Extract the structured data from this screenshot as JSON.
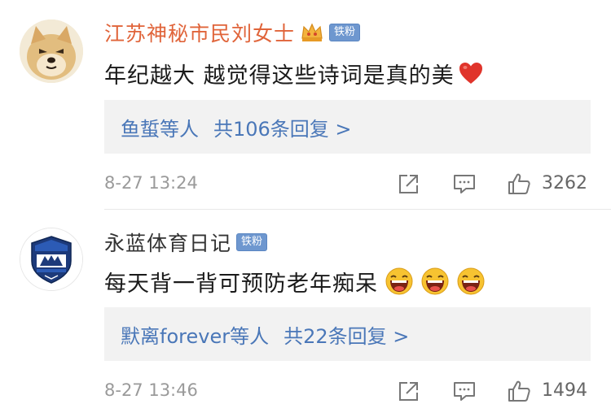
{
  "comments": [
    {
      "username": "江苏神秘市民刘女士",
      "badge": "铁粉",
      "text": "年纪越大 越觉得这些诗词是真的美",
      "reply_users": "鱼蜇等人",
      "reply_count": "共106条回复 >",
      "timestamp": "8-27 13:24",
      "likes": "3262",
      "avatar_icon": "doge-avatar",
      "username_color": "#e0643a",
      "trailing_icon": "heart-emoji"
    },
    {
      "username": "永蓝体育日记",
      "badge": "铁粉",
      "text": "每天背一背可预防老年痴呆",
      "reply_users": "默离forever等人",
      "reply_count": "共22条回复 >",
      "timestamp": "8-27 13:46",
      "likes": "1494",
      "avatar_icon": "football-club-crest-avatar",
      "username_color": "#333333",
      "trailing_icon": "laughing-emoji"
    }
  ],
  "colors": {
    "link": "#4a77b8",
    "badge_bg": "#6e97cf",
    "meta_text": "#9a9a9a",
    "reply_bg": "#f2f2f2"
  }
}
